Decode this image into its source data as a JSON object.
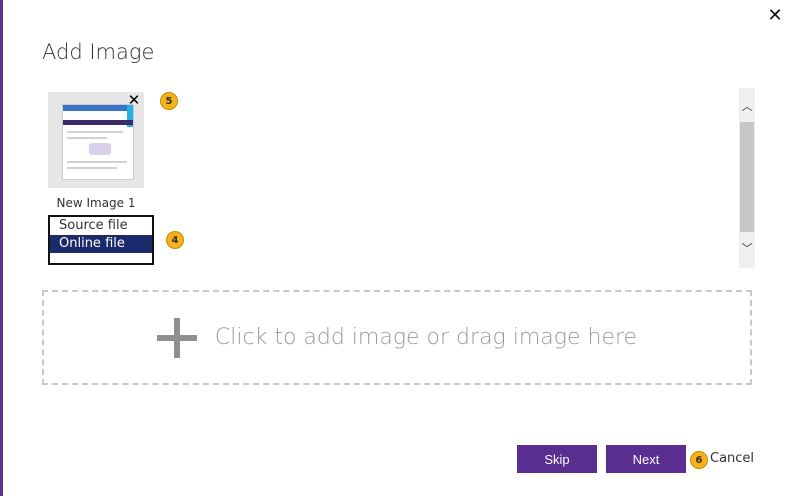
{
  "dialog": {
    "title": "Add Image",
    "close_icon": "close-icon"
  },
  "images": [
    {
      "caption": "New Image 1",
      "remove_icon": "close-icon"
    }
  ],
  "source_dropdown": {
    "options": [
      "Source file",
      "Online file"
    ],
    "selected": "Online file"
  },
  "dropzone": {
    "icon": "plus-icon",
    "text": "Click to add image or drag image here"
  },
  "badges": {
    "b4": "4",
    "b5": "5",
    "b6": "6"
  },
  "buttons": {
    "skip": "Skip",
    "next": "Next",
    "cancel": "Cancel"
  },
  "colors": {
    "accent": "#5a2d91",
    "selection": "#1b2a6b",
    "badge": "#f5b21b"
  }
}
